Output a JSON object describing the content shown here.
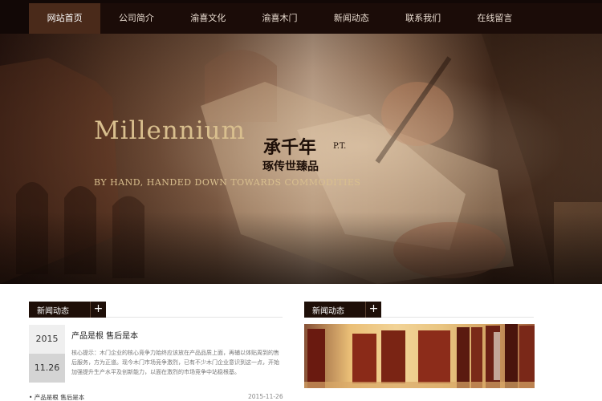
{
  "nav": {
    "items": [
      "网站首页",
      "公司简介",
      "渝喜文化",
      "渝喜木门",
      "新闻动态",
      "联系我们",
      "在线留言"
    ],
    "active": 0
  },
  "hero": {
    "title": "Millennium",
    "cn_line1": "承千年",
    "mark": "P.T.",
    "cn_line2": "琢传世臻品",
    "subtitle": "BY HAND, HANDED DOWN TOWARDS COMMODITIES"
  },
  "news_section": {
    "heading": "新闻动态",
    "plus": "+",
    "featured": {
      "year": "2015",
      "day": "11.26",
      "title": "产品是根 售后是本",
      "desc": "核心提示：木门企业的核心竞争力始终应该放在产品品质上面，再辅以体贴周到的售后服务，方为正道。现今木门市场竞争激烈，已有不少木门企业意识到这一点，开始加强提升生产水平及创新能力，以面在激烈的市场竞争中站稳根基。"
    },
    "list": [
      {
        "title": "• 产品是根 售后是本",
        "date": "2015-11-26"
      }
    ]
  },
  "products_section": {
    "heading": "新闻动态",
    "plus": "+"
  },
  "colors": {
    "nav_bg": "#1b0c08",
    "nav_active": "#4a2a1a",
    "heading_bg": "#1e0f08",
    "hero_gold": "#d9bf8e"
  }
}
